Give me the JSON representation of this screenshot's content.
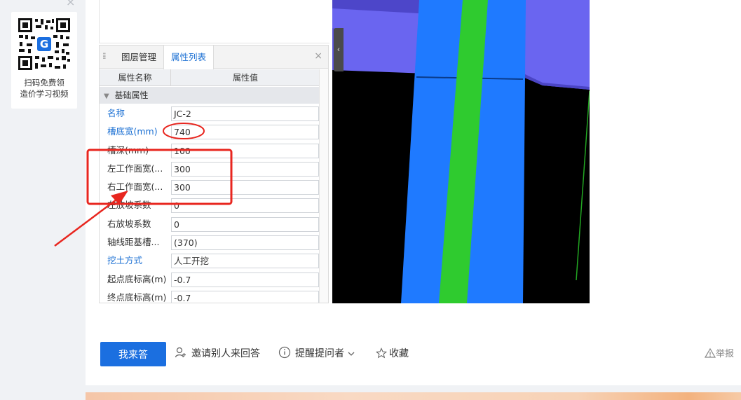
{
  "qr_widget": {
    "close": "×",
    "line1": "扫码免费领",
    "line2": "造价学习视频"
  },
  "panel": {
    "tab_layers": "图层管理",
    "tab_props": "属性列表",
    "close": "×",
    "col_name": "属性名称",
    "col_value": "属性值",
    "group": "基础属性",
    "rows": [
      {
        "name": "名称",
        "value": "JC-2"
      },
      {
        "name": "槽底宽(mm)",
        "value": "740"
      },
      {
        "name": "槽深(mm)",
        "value": "100"
      },
      {
        "name": "左工作面宽(...",
        "value": "300"
      },
      {
        "name": "右工作面宽(...",
        "value": "300"
      },
      {
        "name": "左放坡系数",
        "value": "0"
      },
      {
        "name": "右放坡系数",
        "value": "0"
      },
      {
        "name": "轴线距基槽...",
        "value": "(370)"
      },
      {
        "name": "挖土方式",
        "value": "人工开挖"
      },
      {
        "name": "起点底标高(m)",
        "value": "-0.7"
      },
      {
        "name": "终点底标高(m)",
        "value": "-0.7"
      }
    ],
    "collapse_arrow": "‹"
  },
  "actions": {
    "answer": "我来答",
    "invite": "邀请别人来回答",
    "remind": "提醒提问者",
    "favorite": "收藏",
    "report": "举报"
  },
  "colors": {
    "primary": "#1b6fe0",
    "link_blue": "#1a6fd3",
    "annotation_red": "#e8261f",
    "viewport_black": "#000000",
    "viewport_purple": "#6a65f0",
    "viewport_blue": "#1f7aff",
    "viewport_green": "#2fcb2f"
  },
  "icons": {
    "invite": "add-user-icon",
    "remind": "info-circle-icon",
    "favorite": "star-icon",
    "report": "warning-icon"
  }
}
